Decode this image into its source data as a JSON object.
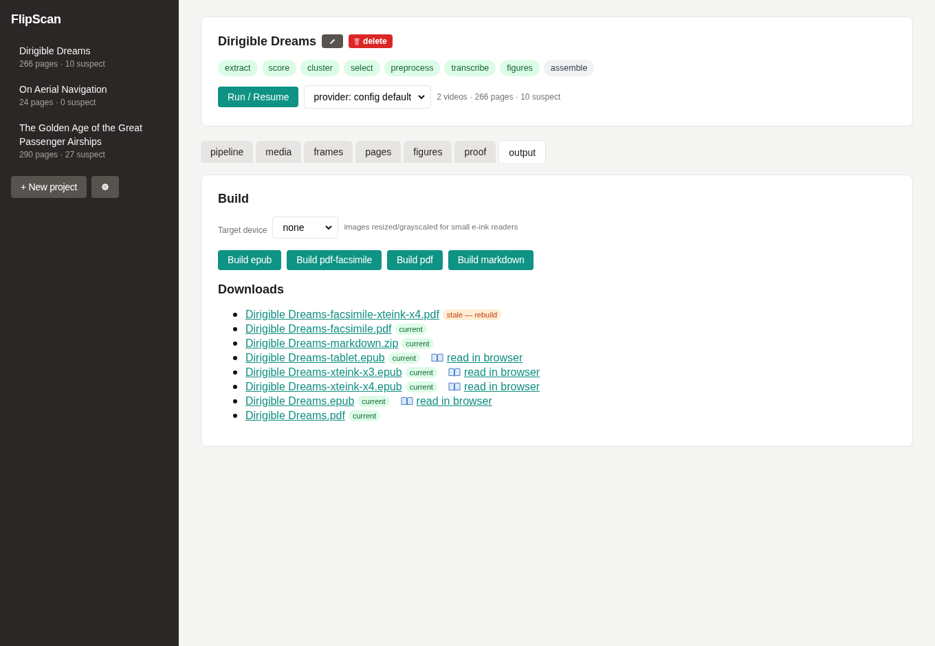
{
  "sidebar": {
    "brand": "FlipScan",
    "projects": [
      {
        "name": "Dirigible Dreams",
        "meta": "266 pages · 10 suspect"
      },
      {
        "name": "On Aerial Navigation",
        "meta": "24 pages · 0 suspect"
      },
      {
        "name": "The Golden Age of the Great Passenger Airships",
        "meta": "290 pages · 27 suspect"
      }
    ],
    "new_button": "+ New project"
  },
  "project": {
    "title": "Dirigible Dreams",
    "delete_button": "delete",
    "stages": [
      {
        "label": "extract",
        "done": true
      },
      {
        "label": "score",
        "done": true
      },
      {
        "label": "cluster",
        "done": true
      },
      {
        "label": "select",
        "done": true
      },
      {
        "label": "preprocess",
        "done": true
      },
      {
        "label": "transcribe",
        "done": true
      },
      {
        "label": "figures",
        "done": true
      },
      {
        "label": "assemble",
        "done": false
      }
    ],
    "run_button": "Run / Resume",
    "provider_select": "provider: config default",
    "summary": "2 videos · 266 pages · 10 suspect"
  },
  "tabs": [
    {
      "label": "pipeline",
      "selected": false
    },
    {
      "label": "media",
      "selected": false
    },
    {
      "label": "frames",
      "selected": false
    },
    {
      "label": "pages",
      "selected": false
    },
    {
      "label": "figures",
      "selected": false
    },
    {
      "label": "proof",
      "selected": false
    },
    {
      "label": "output",
      "selected": true
    }
  ],
  "build": {
    "heading": "Build",
    "target_label": "Target device",
    "target_select": "none",
    "target_hint": "images resized/grayscaled for small e-ink readers",
    "buttons": [
      "Build epub",
      "Build pdf-facsimile",
      "Build pdf",
      "Build markdown"
    ]
  },
  "downloads": {
    "heading": "Downloads",
    "files": [
      {
        "name": "Dirigible Dreams-facsimile-xteink-x4.pdf",
        "badge": "stale — rebuild",
        "stale": true
      },
      {
        "name": "Dirigible Dreams-facsimile.pdf",
        "badge": "current",
        "stale": false
      },
      {
        "name": "Dirigible Dreams-markdown.zip",
        "badge": "current",
        "stale": false
      },
      {
        "name": "Dirigible Dreams-tablet.epub",
        "badge": "current",
        "stale": false,
        "read_link": "read in browser"
      },
      {
        "name": "Dirigible Dreams-xteink-x3.epub",
        "badge": "current",
        "stale": false,
        "read_link": "read in browser"
      },
      {
        "name": "Dirigible Dreams-xteink-x4.epub",
        "badge": "current",
        "stale": false,
        "read_link": "read in browser"
      },
      {
        "name": "Dirigible Dreams.epub",
        "badge": "current",
        "stale": false,
        "read_link": "read in browser"
      },
      {
        "name": "Dirigible Dreams.pdf",
        "badge": "current",
        "stale": false
      }
    ]
  }
}
